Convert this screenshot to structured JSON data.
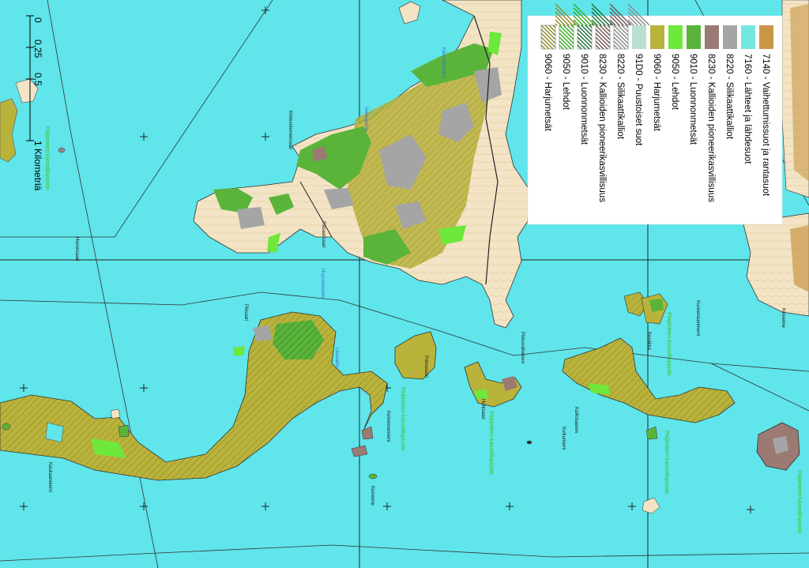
{
  "legend": {
    "items": [
      {
        "code": "7140",
        "label": "7140 - Vaihettumissuot ja rantasuot",
        "color": "#c99746",
        "hatched": false
      },
      {
        "code": "7160",
        "label": "7160 - Lähteet ja lähdesuot",
        "color": "#74e7e0",
        "hatched": false
      },
      {
        "code": "8220",
        "label": "8220 - Silikaattikalliot",
        "color": "#a5a5a5",
        "hatched": false
      },
      {
        "code": "8230",
        "label": "8230 - Kallioiden pioneerikasvillisuus",
        "color": "#9a7a72",
        "hatched": false
      },
      {
        "code": "9010",
        "label": "9010 - Luonnonmetsät",
        "color": "#5ab43a",
        "hatched": false
      },
      {
        "code": "9050",
        "label": "9050 - Lehdot",
        "color": "#6ee83a",
        "hatched": false
      },
      {
        "code": "9060",
        "label": "9060 - Harjumetsät",
        "color": "#b9b33c",
        "hatched": false
      },
      {
        "code": "91D0",
        "label": "91D0 - Puustoiset suot",
        "color": "#b7e0cf",
        "hatched": false
      },
      {
        "code": "8220h",
        "label": "8220 - Silikaattikalliot",
        "color": "#a5a5a5",
        "hatched": true
      },
      {
        "code": "8230h",
        "label": "8230 - Kallioiden pioneerikasvillisuus",
        "color": "#9a7a72",
        "hatched": true
      },
      {
        "code": "9010h",
        "label": "9010 - Luonnonmetsät",
        "color": "#2f9a55",
        "hatched": true
      },
      {
        "code": "9050h",
        "label": "9050 - Lehdot",
        "color": "#6ee83a",
        "hatched": true
      },
      {
        "code": "9060h",
        "label": "9060 - Harjumetsät",
        "color": "#b9b33c",
        "hatched": true
      }
    ]
  },
  "scale_bar": {
    "labels": [
      "0",
      "0,25",
      "0,5"
    ],
    "unit_label": "1 Kilometriä"
  },
  "place_labels": [
    "Hevonsaari",
    "Kirkkoniemensaari",
    "Rasaansaari",
    "Piksaari",
    "Pikkuvalkeinen",
    "Kesäkka",
    "Päijänteen kansallispuisto",
    "Päijänteen kansallispuisto",
    "Päijänteen kansallispuisto",
    "Päijänteen kansallispuisto",
    "Päijänteen kansallispuisto",
    "Päijänteen kansallispuisto",
    "Kelvenneniemi",
    "Palossaari",
    "Huhtsaari",
    "Kelvenne",
    "Kalliosaaren",
    "Kuorentaanniemi",
    "Kulkuniemi",
    "Kaukaanniemi",
    "Kelvenne"
  ],
  "water_labels": [
    "Kärmeänsalmi",
    "Hoysaiansalmi",
    "Likasalmi",
    "Vehkapohja"
  ],
  "colors": {
    "water": "#5fe5ea",
    "land": "#f2e4c5",
    "harjumetsat": "#b9b33c",
    "luonnonmetsat": "#5ab43a",
    "lehdot": "#6ee83a",
    "silikaatti": "#a5a5a5",
    "pioneeri": "#9a7a72",
    "vaihettumis": "#c99746"
  }
}
